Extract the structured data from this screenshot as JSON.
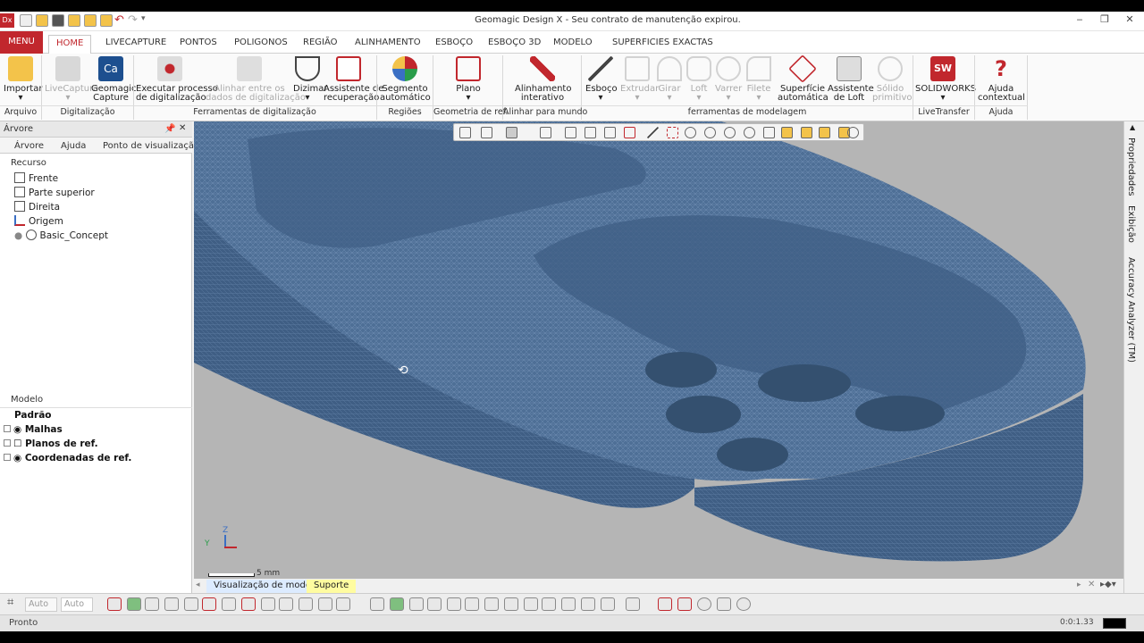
{
  "window": {
    "title": "Geomagic Design X - Seu contrato de manutenção expirou."
  },
  "tabs": {
    "menu": "MENU",
    "items": [
      "HOME",
      "LIVECAPTURE",
      "PONTOS",
      "POLIGONOS",
      "REGIÃO",
      "ALINHAMENTO",
      "ESBOÇO",
      "ESBOÇO 3D",
      "MODELO",
      "SUPERFICIES EXACTAS"
    ],
    "active": "HOME"
  },
  "ribbon": {
    "buttons": [
      {
        "l1": "Importar",
        "l2": "",
        "disabled": false,
        "icon": "import-folder-icon"
      },
      {
        "l1": "LiveCapture",
        "l2": "",
        "disabled": true,
        "icon": "livecapture-icon"
      },
      {
        "l1": "Geomagic",
        "l2": "Capture",
        "disabled": false,
        "icon": "geomagic-capture-icon"
      },
      {
        "l1": "Executar processo",
        "l2": "de digitalização",
        "disabled": false,
        "icon": "scan-process-icon"
      },
      {
        "l1": "Alinhar entre os",
        "l2": "dados de digitalização",
        "disabled": true,
        "icon": "align-scan-icon"
      },
      {
        "l1": "Dizimar",
        "l2": "",
        "disabled": false,
        "icon": "decimate-icon"
      },
      {
        "l1": "Assistente de",
        "l2": "recuperação",
        "disabled": false,
        "icon": "healing-wizard-icon"
      },
      {
        "l1": "Segmento",
        "l2": "automático",
        "disabled": false,
        "icon": "auto-segment-icon"
      },
      {
        "l1": "Plano",
        "l2": "",
        "disabled": false,
        "icon": "plane-icon"
      },
      {
        "l1": "Alinhamento",
        "l2": "interativo",
        "disabled": false,
        "icon": "interactive-align-icon"
      },
      {
        "l1": "Esboço",
        "l2": "",
        "disabled": false,
        "icon": "sketch-icon"
      },
      {
        "l1": "Extrudar",
        "l2": "",
        "disabled": true,
        "icon": "extrude-icon"
      },
      {
        "l1": "Girar",
        "l2": "",
        "disabled": true,
        "icon": "revolve-icon"
      },
      {
        "l1": "Loft",
        "l2": "",
        "disabled": true,
        "icon": "loft-icon"
      },
      {
        "l1": "Varrer",
        "l2": "",
        "disabled": true,
        "icon": "sweep-icon"
      },
      {
        "l1": "Filete",
        "l2": "",
        "disabled": true,
        "icon": "fillet-icon"
      },
      {
        "l1": "Superfície",
        "l2": "automática",
        "disabled": false,
        "icon": "auto-surface-icon"
      },
      {
        "l1": "Assistente",
        "l2": "de Loft",
        "disabled": false,
        "icon": "loft-wizard-icon"
      },
      {
        "l1": "Sólido",
        "l2": "primitivo",
        "disabled": true,
        "icon": "solid-primitive-icon"
      },
      {
        "l1": "SOLIDWORKS",
        "l2": "",
        "disabled": false,
        "icon": "solidworks-icon"
      },
      {
        "l1": "Ajuda",
        "l2": "contextual",
        "disabled": false,
        "icon": "help-icon"
      }
    ],
    "groups": [
      "Arquivo",
      "Digitalização",
      "Ferramentas de digitalização",
      "Regiões",
      "Geometria de ref.",
      "Alinhar para mundo",
      "ferramentas de modelagem",
      "LiveTransfer",
      "Ajuda"
    ]
  },
  "left_panel": {
    "header": "Árvore",
    "tabs": [
      "Árvore",
      "Ajuda",
      "Ponto de visualização"
    ],
    "recurso_label": "Recurso",
    "tree": [
      "Frente",
      "Parte superior",
      "Direita",
      "Origem",
      "Basic_Concept"
    ],
    "modelo_label": "Modelo",
    "default_label": "Padrão",
    "model_items": [
      "Malhas",
      "Planos de ref.",
      "Coordenadas de ref."
    ]
  },
  "viewport": {
    "scale_label": "5 mm",
    "axis_z": "Z",
    "axis_y": "Y",
    "mesh_color": "#4e6f96"
  },
  "right_panel": {
    "tabs": [
      "Propriedades",
      "Exibição",
      "Accuracy Analyzer (TM)"
    ]
  },
  "view_tabs": [
    "Visualização de modelo",
    "Suporte"
  ],
  "bottom": {
    "auto1": "Auto",
    "auto2": "Auto"
  },
  "status": {
    "text": "Pronto",
    "time": "0:0:1.33"
  }
}
